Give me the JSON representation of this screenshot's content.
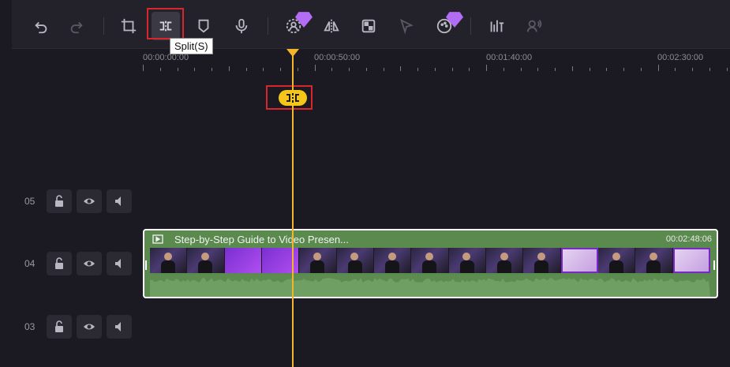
{
  "toolbar": {
    "tooltip": "Split(S)",
    "tools": [
      {
        "name": "undo-icon"
      },
      {
        "name": "redo-icon"
      },
      {
        "name": "crop-icon"
      },
      {
        "name": "split-icon"
      },
      {
        "name": "marker-icon"
      },
      {
        "name": "microphone-icon"
      },
      {
        "name": "ai-portrait-icon"
      },
      {
        "name": "mirror-icon"
      },
      {
        "name": "mosaic-icon"
      },
      {
        "name": "motion-tracking-icon"
      },
      {
        "name": "color-icon"
      },
      {
        "name": "audio-adjust-icon"
      },
      {
        "name": "voice-icon"
      }
    ]
  },
  "ruler": {
    "labels": [
      "00:00:00:00",
      "00:00:50:00",
      "00:01:40:00",
      "00:02:30:00"
    ]
  },
  "tracks": [
    {
      "number": "05"
    },
    {
      "number": "04"
    },
    {
      "number": "03"
    }
  ],
  "clip": {
    "title": "Step-by-Step Guide to Video Presen...",
    "duration": "00:02:48:06"
  },
  "colors": {
    "playhead": "#f5b52b",
    "highlight": "#d9262c",
    "clip": "#5b8a4f"
  }
}
